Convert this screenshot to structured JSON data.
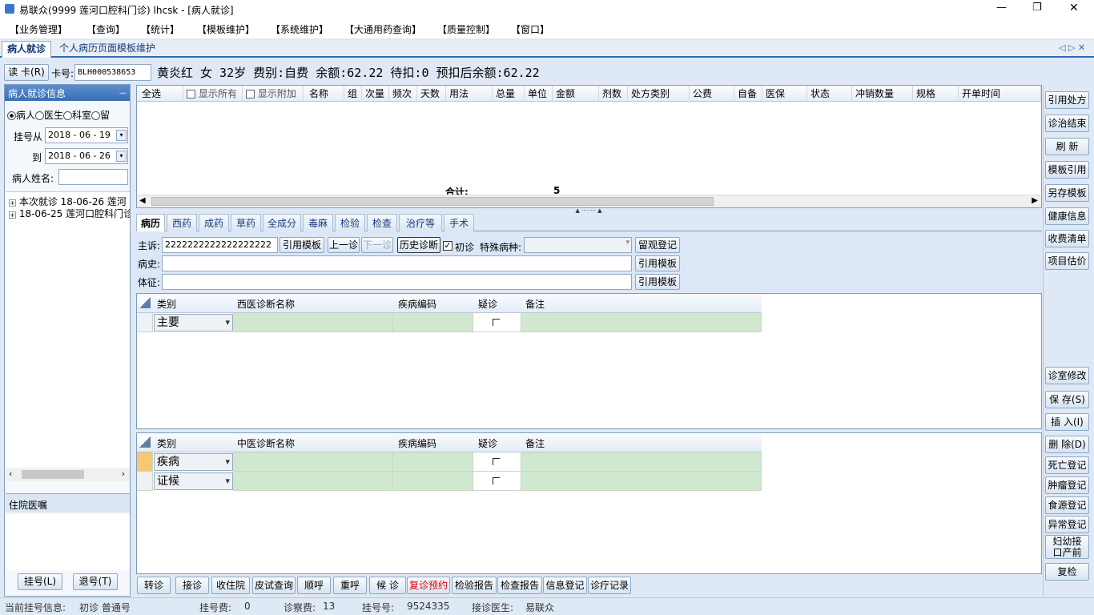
{
  "window": {
    "title": "易联众(9999 莲河口腔科门诊) lhcsk - [病人就诊]",
    "minimize": "—",
    "restore": "❐",
    "close": "✕"
  },
  "menu": [
    "【业务管理】",
    "【查询】",
    "【统计】",
    "【模板维护】",
    "【系统维护】",
    "【大通用药查询】",
    "【质量控制】",
    "【窗口】"
  ],
  "tabs": {
    "active": "病人就诊",
    "other": "个人病历页面模板维护",
    "nav": "◁ ▷ ✕"
  },
  "patient_bar": {
    "read_card": "读 卡(R)",
    "card_label": "卡号:",
    "card_no": "BLH000538653",
    "info": "黄炎红 女 32岁 费别:自费 余额:62.22 待扣:0 预扣后余额:62.22"
  },
  "left": {
    "title": "病人就诊信息",
    "pin": "ᅮ",
    "radios": [
      "病人",
      "医生",
      "科室",
      "留"
    ],
    "date_from_label": "挂号从",
    "date_from": "2018 - 06 - 19",
    "date_to_label": "到",
    "date_to": "2018 - 06 - 26",
    "name_label": "病人姓名:",
    "name_value": "",
    "tree": [
      "本次就诊 18-06-26 莲河",
      "18-06-25 莲河口腔科门诊"
    ],
    "inpatient_title": "住院医嘱",
    "register": "挂号(L)",
    "unregister": "退号(T)"
  },
  "rx_table": {
    "select_all": "全选",
    "show_all": "显示所有",
    "show_extra": "显示附加",
    "columns": [
      "名称",
      "组",
      "次量",
      "频次",
      "天数",
      "用法",
      "总量",
      "单位",
      "金额",
      "剂数",
      "处方类别",
      "公费",
      "自备",
      "医保",
      "状态",
      "冲销数量",
      "规格",
      "开单时间"
    ],
    "total_label": "合计:",
    "total_value": "5"
  },
  "subtabs": [
    "病历",
    "西药",
    "成药",
    "草药",
    "全成分",
    "毒麻",
    "检验",
    "检查",
    "治疗等",
    "手术"
  ],
  "record": {
    "complaint_label": "主诉:",
    "complaint": "2222222222222222222",
    "history_label": "病史:",
    "history": "",
    "sign_label": "体征:",
    "sign": "",
    "cite_template": "引用模板",
    "prev": "上一诊",
    "next": "下一诊",
    "history_diag": "历史诊断",
    "first_visit": "初诊",
    "special_label": "特殊病种:",
    "special_value": "",
    "observe_reg": "留观登记"
  },
  "western": {
    "headers": [
      "类别",
      "西医诊断名称",
      "疾病编码",
      "疑诊",
      "备注"
    ],
    "row_type": "主要"
  },
  "chinese": {
    "headers": [
      "类别",
      "中医诊断名称",
      "疾病编码",
      "疑诊",
      "备注"
    ],
    "rows": [
      "疾病",
      "证候"
    ]
  },
  "right_buttons_top": [
    "引用处方",
    "诊治结束",
    "刷 新",
    "模板引用",
    "另存模板",
    "健康信息",
    "收费清单",
    "项目估价"
  ],
  "right_buttons_bottom": [
    "诊室修改",
    "保 存(S)",
    "插 入(I)",
    "删 除(D)",
    "死亡登记",
    "肿瘤登记",
    "食源登记",
    "异常登记",
    "妇幼接口产前检查",
    "复检"
  ],
  "bottom_buttons": [
    "转诊",
    "接诊",
    "收住院",
    "皮试查询",
    "顺呼",
    "重呼",
    "候 诊",
    "复诊预约",
    "检验报告",
    "检查报告",
    "信息登记",
    "诊疗记录"
  ],
  "status": {
    "reg_info_label": "当前挂号信息:",
    "reg_info": "初诊 普通号",
    "reg_fee_label": "挂号费:",
    "reg_fee": "0",
    "diag_fee_label": "诊察费:",
    "diag_fee": "13",
    "reg_no_label": "挂号号:",
    "reg_no": "9524335",
    "doctor_label": "接诊医生:",
    "doctor": "易联众"
  },
  "colors": {
    "accent": "#2f6cb5",
    "grid_green": "#cfe8cf",
    "red_text": "#e00000"
  }
}
